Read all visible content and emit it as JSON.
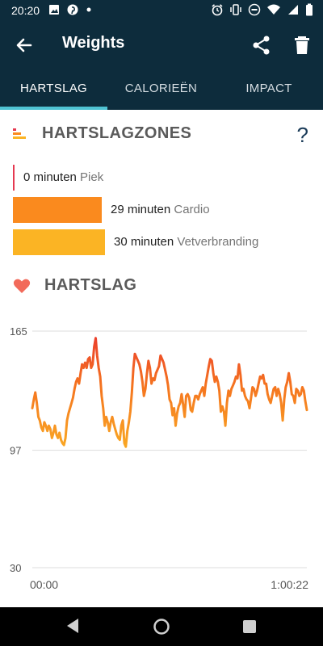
{
  "status_bar": {
    "time": "20:20",
    "icons": [
      "image-icon",
      "pinterest-icon",
      "notification-dot-icon",
      "alarm-icon",
      "vibrate-icon",
      "do-not-disturb-icon",
      "wifi-icon",
      "signal-icon",
      "battery-icon"
    ]
  },
  "app_bar": {
    "title": "Weights"
  },
  "tabs": [
    {
      "label": "HARTSLAG",
      "active": true
    },
    {
      "label": "CALORIEËN",
      "active": false
    },
    {
      "label": "IMPACT",
      "active": false
    }
  ],
  "zones_section": {
    "title": "HARTSLAGZONES",
    "help": "?",
    "zones": [
      {
        "minutes": "0 minuten",
        "name": "Piek",
        "color": "#e53950"
      },
      {
        "minutes": "29 minuten",
        "name": "Cardio",
        "color": "#fa8a1e"
      },
      {
        "minutes": "30 minuten",
        "name": "Vetverbranding",
        "color": "#fbb424"
      }
    ]
  },
  "heartrate_section": {
    "title": "HARTSLAG"
  },
  "chart_data": {
    "type": "line",
    "y_ticks": [
      "165",
      "97",
      "30"
    ],
    "ylim": [
      30,
      165
    ],
    "x_labels": [
      "00:00",
      "1:00:22"
    ],
    "series": [
      {
        "values": [
          121,
          126,
          130,
          124,
          116,
          114,
          110,
          108,
          113,
          111,
          108,
          111,
          109,
          104,
          107,
          111,
          106,
          104,
          107,
          103,
          101,
          100,
          104,
          114,
          118,
          121,
          124,
          127,
          132,
          136,
          138,
          135,
          141,
          146,
          144,
          147,
          144,
          149,
          150,
          144,
          146,
          156,
          161,
          151,
          144,
          139,
          128,
          121,
          111,
          116,
          113,
          108,
          113,
          116,
          112,
          109,
          106,
          104,
          103,
          111,
          114,
          101,
          99,
          108,
          113,
          119,
          130,
          144,
          152,
          150,
          148,
          146,
          142,
          136,
          128,
          132,
          141,
          148,
          144,
          135,
          138,
          137,
          141,
          143,
          145,
          151,
          149,
          147,
          143,
          139,
          134,
          126,
          124,
          117,
          121,
          111,
          118,
          122,
          124,
          129,
          123,
          116,
          128,
          129,
          127,
          120,
          119,
          124,
          128,
          128,
          126,
          129,
          131,
          133,
          128,
          135,
          140,
          145,
          149,
          148,
          141,
          136,
          139,
          136,
          131,
          119,
          122,
          119,
          111,
          124,
          131,
          128,
          132,
          134,
          136,
          139,
          138,
          146,
          140,
          131,
          132,
          128,
          126,
          125,
          121,
          127,
          133,
          132,
          128,
          131,
          135,
          139,
          138,
          140,
          135,
          135,
          129,
          126,
          124,
          128,
          132,
          133,
          128,
          132,
          129,
          124,
          114,
          126,
          133,
          136,
          141,
          136,
          129,
          128,
          124,
          132,
          131,
          128,
          129,
          133,
          131,
          125,
          120
        ],
        "color": "#f07020"
      }
    ]
  },
  "nav": {
    "buttons": [
      "back-nav-icon",
      "home-nav-icon",
      "recents-nav-icon"
    ]
  }
}
